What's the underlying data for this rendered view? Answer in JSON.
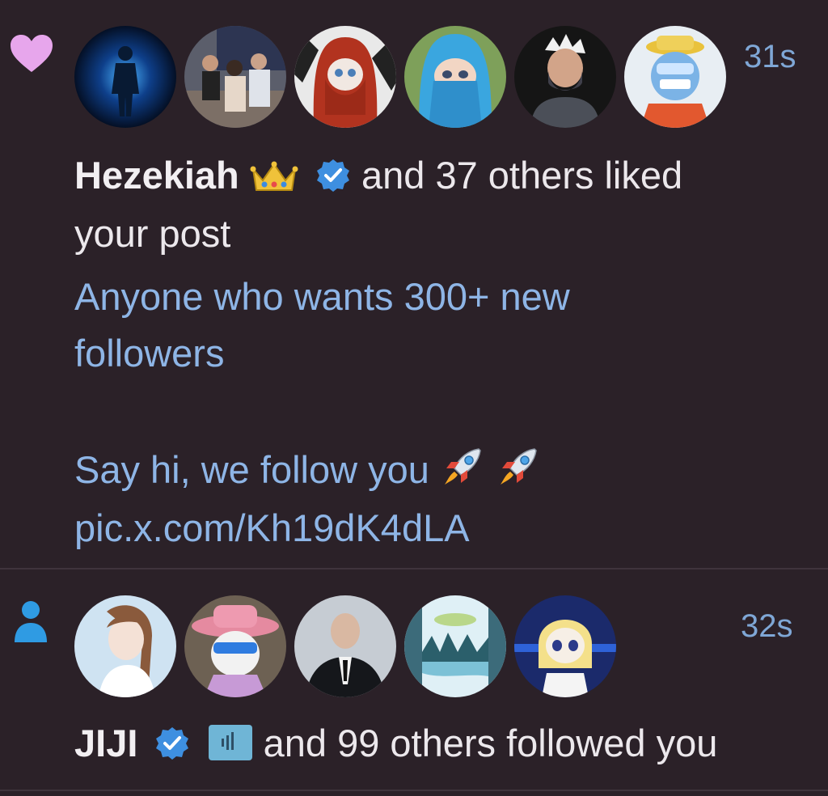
{
  "colors": {
    "background": "#2b2128",
    "divider": "#3f343c",
    "heart": "#e7a6ec",
    "follow_icon": "#2f9be3",
    "link_text": "#8eb5e6",
    "timestamp": "#7fa7d6",
    "verified": "#3e8fe0"
  },
  "notifications": [
    {
      "type_icon": "heart-icon",
      "timestamp": "31s",
      "avatars": [
        "glowing-figure",
        "event-crowd",
        "red-haired-cartoon",
        "blue-hijab-anime",
        "bearded-warrior",
        "cartoon-ape-hat"
      ],
      "actor": "Hezekiah",
      "actor_badges": [
        "crown-emoji",
        "verified-badge"
      ],
      "action_suffix": "and 37 others liked",
      "action_line2": "your post",
      "post_line1": "Anyone who wants 300+ new",
      "post_line2": "followers",
      "post_line3": "Say hi, we follow you",
      "post_emojis": [
        "rocket-emoji",
        "rocket-emoji"
      ],
      "post_link": "pic.x.com/Kh19dK4dLA"
    },
    {
      "type_icon": "person-icon",
      "timestamp": "32s",
      "avatars": [
        "braided-anime-girl",
        "pink-hat-sunglasses",
        "bald-man-suit",
        "winter-landscape",
        "blonde-cartoon"
      ],
      "actor": "JIJI",
      "actor_badges": [
        "verified-badge",
        "affiliate-badge"
      ],
      "action_suffix": "and 99 others followed you"
    }
  ]
}
